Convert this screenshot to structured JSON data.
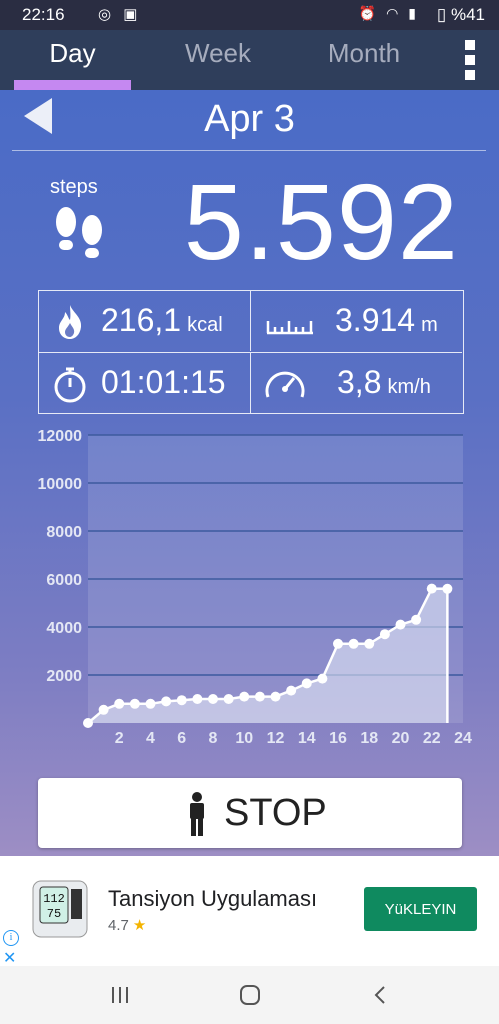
{
  "status_bar": {
    "time": "22:16",
    "battery": "%41",
    "left_icons": [
      "whatsapp-icon",
      "vine-icon"
    ],
    "right_icons": [
      "alarm-icon",
      "wifi-icon",
      "signal-icon",
      "battery-icon"
    ]
  },
  "tabs": [
    {
      "label": "Day",
      "active": true
    },
    {
      "label": "Week",
      "active": false
    },
    {
      "label": "Month",
      "active": false
    }
  ],
  "accent_color": "#c588f1",
  "date": {
    "label": "Apr 3"
  },
  "steps": {
    "label": "steps",
    "value": "5.592"
  },
  "stats": {
    "calories": {
      "value": "216,1",
      "unit": "kcal"
    },
    "distance": {
      "value": "3.914",
      "unit": "m"
    },
    "duration": {
      "value": "01:01:15"
    },
    "speed": {
      "value": "3,8",
      "unit": "km/h"
    }
  },
  "chart_data": {
    "type": "area",
    "title": "",
    "xlabel": "",
    "ylabel": "",
    "xlim": [
      0,
      24
    ],
    "ylim": [
      0,
      12000
    ],
    "xticks": [
      2,
      4,
      6,
      8,
      10,
      12,
      14,
      16,
      18,
      20,
      22,
      24
    ],
    "yticks": [
      2000,
      4000,
      6000,
      8000,
      10000,
      12000
    ],
    "grid": true,
    "x": [
      0,
      1,
      2,
      3,
      4,
      5,
      6,
      7,
      8,
      9,
      10,
      11,
      12,
      13,
      14,
      15,
      16,
      17,
      18,
      19,
      20,
      21,
      22,
      23
    ],
    "series": [
      {
        "values": [
          0,
          550,
          800,
          800,
          800,
          900,
          950,
          1000,
          1000,
          1000,
          1100,
          1100,
          1100,
          1350,
          1650,
          1850,
          3300,
          3300,
          3300,
          3700,
          4100,
          4300,
          5600,
          5592
        ]
      }
    ]
  },
  "stop_button": {
    "label": "STOP"
  },
  "ad": {
    "title": "Tansiyon Uygulaması",
    "rating": "4.7",
    "install_label": "YüKLEYIN",
    "icon_readings": [
      "112",
      "75"
    ]
  }
}
